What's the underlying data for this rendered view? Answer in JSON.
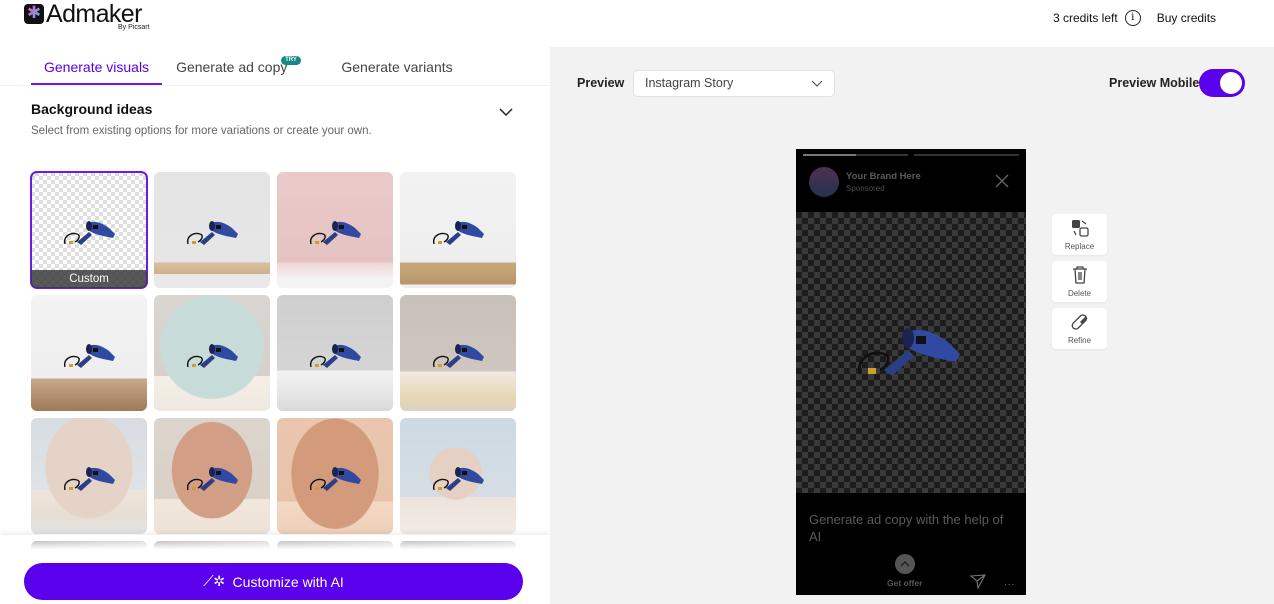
{
  "header": {
    "logo_text": "Admaker",
    "logo_sub": "By Picsart",
    "credits_text": "3 credits left",
    "buy_label": "Buy credits"
  },
  "tabs": [
    {
      "label": "Generate visuals",
      "active": true
    },
    {
      "label": "Generate ad copy",
      "badge": "TRY"
    },
    {
      "label": "Generate variants"
    }
  ],
  "background_ideas": {
    "title": "Background ideas",
    "description": "Select from existing options for more variations or create your own.",
    "thumbnails": [
      {
        "label": "Custom",
        "selected": true,
        "style": "transparent"
      },
      {
        "style": "leaves-wood-gray"
      },
      {
        "style": "pink-plants"
      },
      {
        "style": "white-leaves-wood-slab"
      },
      {
        "style": "leaves-wood-shelf"
      },
      {
        "style": "teal-vase-podium"
      },
      {
        "style": "gray-stone-podium"
      },
      {
        "style": "taupe-stone-podium"
      },
      {
        "style": "beige-arch-blue"
      },
      {
        "style": "terracotta-arch"
      },
      {
        "style": "peach-arch"
      },
      {
        "style": "blue-circle-podium"
      }
    ]
  },
  "cta": {
    "label": "Customize with AI"
  },
  "preview": {
    "label": "Preview",
    "format": "Instagram Story",
    "mobile_label": "Preview Mobile",
    "mobile_enabled": true
  },
  "story": {
    "brand": "Your Brand Here",
    "sponsored": "Sponsored",
    "ad_copy_placeholder": "Generate ad copy with the help of AI",
    "offer_label": "Get offer",
    "more": "..."
  },
  "tools": [
    {
      "label": "Replace",
      "icon": "replace-icon"
    },
    {
      "label": "Delete",
      "icon": "trash-icon"
    },
    {
      "label": "Refine",
      "icon": "eraser-icon"
    }
  ],
  "colors": {
    "accent": "#5a00ec",
    "badge": "#138b84"
  }
}
